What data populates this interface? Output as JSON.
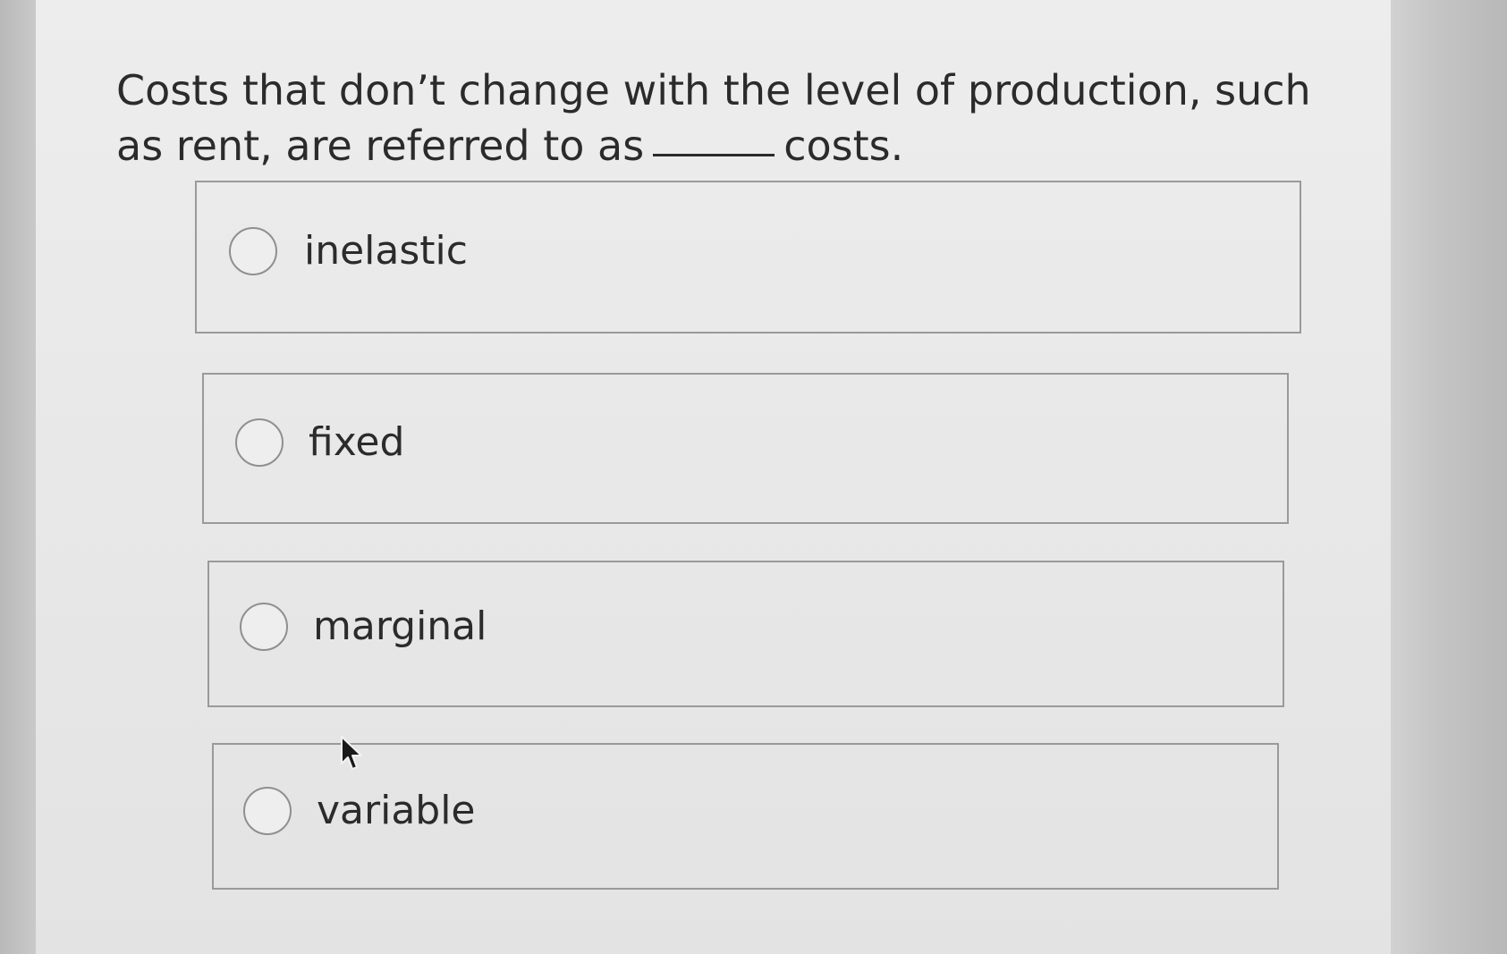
{
  "question": {
    "text_before": "Costs that don’t change with the level of production, such as rent, are referred to as",
    "text_after": "costs."
  },
  "options": [
    {
      "label": "inelastic",
      "selected": false
    },
    {
      "label": "fixed",
      "selected": false
    },
    {
      "label": "marginal",
      "selected": false
    },
    {
      "label": "variable",
      "selected": false
    }
  ],
  "icons": {
    "radio": "radio-circle-icon",
    "cursor": "mouse-pointer-icon"
  }
}
